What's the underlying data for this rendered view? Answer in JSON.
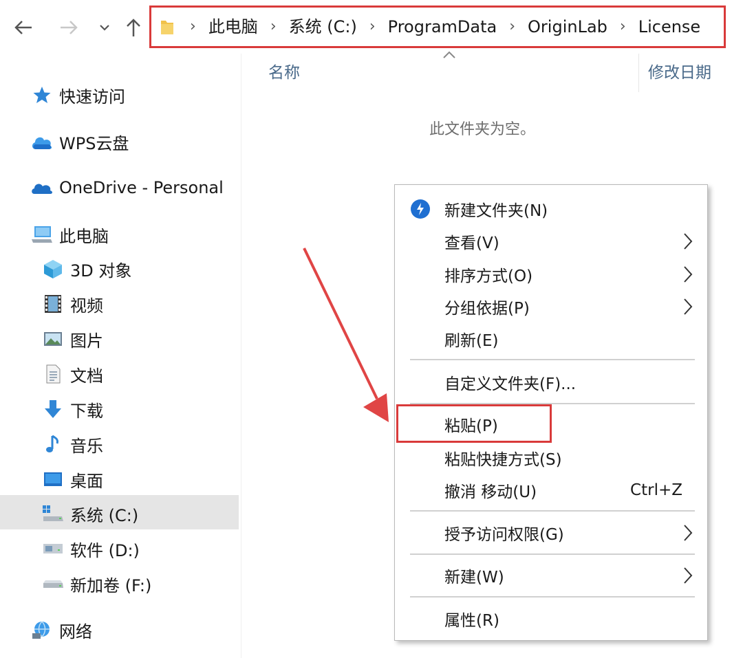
{
  "breadcrumb": [
    "此电脑",
    "系统 (C:)",
    "ProgramData",
    "OriginLab",
    "License"
  ],
  "sidebar": {
    "quick_access": "快速访问",
    "wps": "WPS云盘",
    "onedrive": "OneDrive - Personal",
    "this_pc": "此电脑",
    "items": [
      {
        "label": "3D 对象",
        "icon": "3d-objects-icon"
      },
      {
        "label": "视频",
        "icon": "video-icon"
      },
      {
        "label": "图片",
        "icon": "pictures-icon"
      },
      {
        "label": "文档",
        "icon": "documents-icon"
      },
      {
        "label": "下载",
        "icon": "download-icon"
      },
      {
        "label": "音乐",
        "icon": "music-icon"
      },
      {
        "label": "桌面",
        "icon": "desktop-icon"
      },
      {
        "label": "系统 (C:)",
        "icon": "system-drive-icon",
        "selected": true
      },
      {
        "label": "软件 (D:)",
        "icon": "drive-icon"
      },
      {
        "label": "新加卷 (F:)",
        "icon": "drive-icon"
      }
    ],
    "network": "网络"
  },
  "main": {
    "col_name": "名称",
    "col_date": "修改日期",
    "empty_message": "此文件夹为空。"
  },
  "context_menu": {
    "items": [
      {
        "label": "新建文件夹(N)",
        "has_icon": true
      },
      {
        "label": "查看(V)",
        "submenu": true
      },
      {
        "label": "排序方式(O)",
        "submenu": true
      },
      {
        "label": "分组依据(P)",
        "submenu": true
      },
      {
        "label": "刷新(E)"
      },
      {
        "label": "自定义文件夹(F)..."
      },
      {
        "label": "粘贴(P)",
        "highlighted": true
      },
      {
        "label": "粘贴快捷方式(S)"
      },
      {
        "label": "撤消 移动(U)",
        "shortcut": "Ctrl+Z"
      },
      {
        "label": "授予访问权限(G)",
        "submenu": true
      },
      {
        "label": "新建(W)",
        "submenu": true
      },
      {
        "label": "属性(R)"
      }
    ]
  },
  "colors": {
    "highlight_red": "#d93a3a",
    "selected_bg": "#e5e5e5",
    "header_text": "#4a6a8a"
  }
}
